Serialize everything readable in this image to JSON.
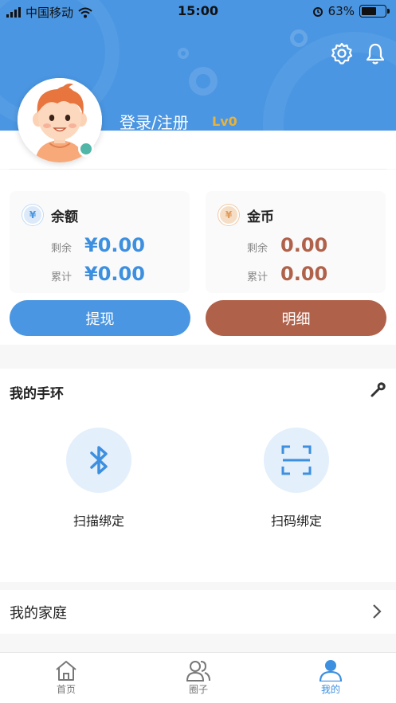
{
  "status_bar": {
    "carrier": "中国移动",
    "time": "15:00",
    "battery": "63%",
    "battery_level": 0.63
  },
  "header": {
    "settings_icon": "gear-icon",
    "notification_icon": "bell-icon"
  },
  "profile": {
    "login_label": "登录/注册",
    "level": "Lv0",
    "avatar_icon": "cartoon-boy-avatar",
    "online_status_color": "#4fb6a8"
  },
  "wallet": {
    "balance": {
      "icon_symbol": "¥",
      "title": "余额",
      "remaining_label": "剩余",
      "remaining_value": "¥0.00",
      "total_label": "累计",
      "total_value": "¥0.00"
    },
    "coins": {
      "icon_symbol": "¥",
      "title": "金币",
      "remaining_label": "剩余",
      "remaining_value": "0.00",
      "total_label": "累计",
      "total_value": "0.00"
    },
    "withdraw_label": "提现",
    "detail_label": "明细"
  },
  "bracelet": {
    "title": "我的手环",
    "settings_icon": "wrench-icon",
    "scan_bind_label": "扫描绑定",
    "scan_icon": "bluetooth-icon",
    "qr_bind_label": "扫码绑定",
    "qr_icon": "scan-frame-icon"
  },
  "family": {
    "title": "我的家庭"
  },
  "tabbar": {
    "items": [
      {
        "label": "首页",
        "icon": "home-icon",
        "active": false
      },
      {
        "label": "圈子",
        "icon": "users-icon",
        "active": false
      },
      {
        "label": "我的",
        "icon": "person-icon",
        "active": true
      }
    ]
  },
  "colors": {
    "primary_blue": "#4a96e2",
    "coin_brown": "#b0614a",
    "level_gold": "#e8b23c"
  }
}
